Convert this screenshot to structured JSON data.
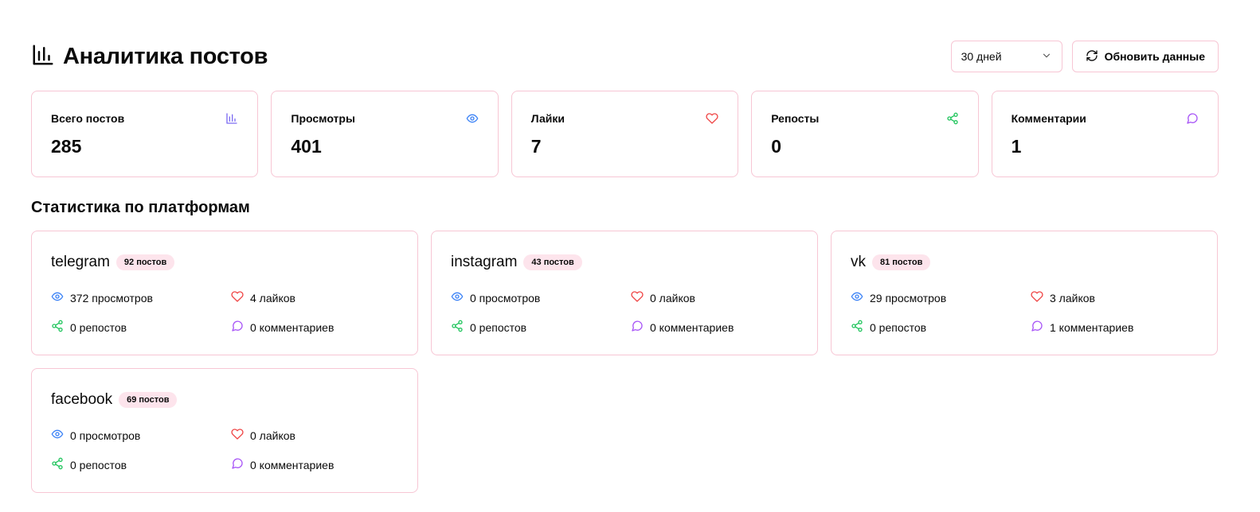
{
  "header": {
    "title": "Аналитика постов",
    "period_select": "30 дней",
    "refresh_button": "Обновить данные"
  },
  "stats": [
    {
      "label": "Всего постов",
      "value": "285",
      "icon": "bar-chart-icon",
      "color": "#7c6cf2"
    },
    {
      "label": "Просмотры",
      "value": "401",
      "icon": "eye-icon",
      "color": "#3b82f6"
    },
    {
      "label": "Лайки",
      "value": "7",
      "icon": "heart-icon",
      "color": "#ef4444"
    },
    {
      "label": "Репосты",
      "value": "0",
      "icon": "share-icon",
      "color": "#22c55e"
    },
    {
      "label": "Комментарии",
      "value": "1",
      "icon": "message-circle-icon",
      "color": "#a855f7"
    }
  ],
  "platforms_section_title": "Статистика по платформам",
  "platforms": [
    {
      "name": "telegram",
      "posts": "92 постов",
      "views": "372 просмотров",
      "likes": "4 лайков",
      "reposts": "0 репостов",
      "comments": "0 комментариев"
    },
    {
      "name": "instagram",
      "posts": "43 постов",
      "views": "0 просмотров",
      "likes": "0 лайков",
      "reposts": "0 репостов",
      "comments": "0 комментариев"
    },
    {
      "name": "vk",
      "posts": "81 постов",
      "views": "29 просмотров",
      "likes": "3 лайков",
      "reposts": "0 репостов",
      "comments": "1 комментариев"
    },
    {
      "name": "facebook",
      "posts": "69 постов",
      "views": "0 просмотров",
      "likes": "0 лайков",
      "reposts": "0 репостов",
      "comments": "0 комментариев"
    }
  ],
  "colors": {
    "border": "#f7c6d4",
    "badge_bg": "#fde4ec",
    "views": "#3b82f6",
    "likes": "#ef4444",
    "reposts": "#22c55e",
    "comments": "#a855f7"
  }
}
